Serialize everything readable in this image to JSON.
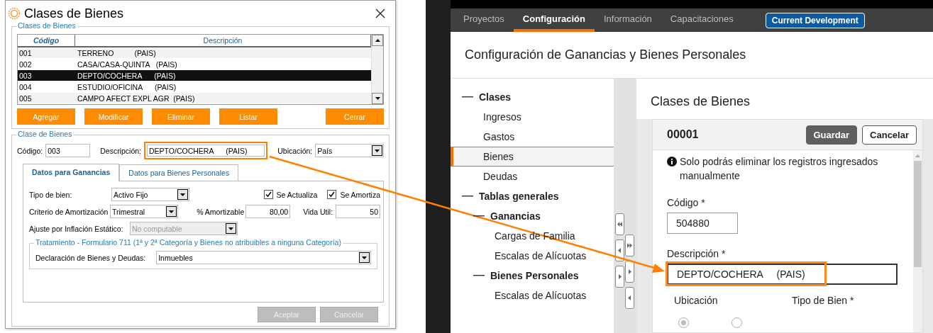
{
  "dialog": {
    "title": "Clases de Bienes",
    "list_group": "Clases de Bienes",
    "table": {
      "columns": [
        "Código",
        "Descripción"
      ],
      "rows": [
        {
          "code": "001",
          "description": "TERRENO          (PAIS)",
          "selected": false
        },
        {
          "code": "002",
          "description": "CASA/CASA-QUINTA   (PAIS)",
          "selected": false
        },
        {
          "code": "003",
          "description": "DEPTO/COCHERA      (PAIS)",
          "selected": true
        },
        {
          "code": "004",
          "description": "ESTUDIO/OFICINA      (PAIS)",
          "selected": false
        },
        {
          "code": "005",
          "description": "CAMPO AFECT EXPL AGR  (PAIS)",
          "selected": false
        }
      ]
    },
    "buttons": [
      {
        "label": "Agregar"
      },
      {
        "label": "Modificar"
      },
      {
        "label": "Eliminar"
      },
      {
        "label": "Listar"
      },
      {
        "label": "Cerrar"
      }
    ],
    "detail_group": "Clase de Bienes",
    "codigo": {
      "label": "Código:",
      "value": "003"
    },
    "descripcion": {
      "label": "Descripción:",
      "value": "DEPTO/COCHERA      (PAIS)",
      "highlighted": true
    },
    "ubicacion": {
      "label": "Ubicación:",
      "value": "País"
    },
    "tabs": [
      {
        "label": "Datos para Ganancias",
        "selected": true
      },
      {
        "label": "Datos para Bienes Personales",
        "selected": false
      }
    ],
    "tipo": {
      "label": "Tipo de bien:",
      "value": "Activo Fijo"
    },
    "checks": [
      {
        "label": "Se Actualiza",
        "checked": true
      },
      {
        "label": "Se Amortiza",
        "checked": true
      }
    ],
    "criterio": {
      "label": "Criterio de Amortización",
      "value": "Trimestral"
    },
    "amortizable": {
      "label": "% Amortizable",
      "value": "80,00"
    },
    "vida": {
      "label": "Vida Util:",
      "value": "50"
    },
    "ajuste": {
      "label": "Ajuste por Inflación Estático:",
      "value": "No computable",
      "disabled": true
    },
    "tratamiento": {
      "title": "Tratamiento - Formulario 711 (1ª y 2ª Categoría y Bienes no atribuibles a ninguna Categoría)",
      "label": "Declaración de Bienes y Deudas:",
      "value": "Inmuebles"
    },
    "footer_buttons": [
      {
        "label": "Aceptar",
        "disabled": true
      },
      {
        "label": "Cancelar",
        "disabled": true
      }
    ]
  },
  "app": {
    "nav": [
      {
        "label": "Proyectos",
        "selected": false
      },
      {
        "label": "Configuración",
        "selected": true
      },
      {
        "label": "Información",
        "selected": false
      },
      {
        "label": "Capacitaciones",
        "selected": false
      }
    ],
    "badge": "Current Development",
    "page_title": "Configuración de Ganancias y Bienes Personales",
    "sidebar": {
      "items": [
        {
          "label": "Clases",
          "expanded": true,
          "selected": false,
          "children": [
            {
              "label": "Ingresos",
              "selected": false
            },
            {
              "label": "Gastos",
              "selected": false
            },
            {
              "label": "Bienes",
              "selected": true
            },
            {
              "label": "Deudas",
              "selected": false
            }
          ]
        },
        {
          "label": "Tablas generales",
          "expanded": true,
          "selected": false,
          "children": [
            {
              "label": "Ganancias",
              "expanded": true,
              "selected": false,
              "children": [
                {
                  "label": "Cargas de Familia",
                  "selected": false
                },
                {
                  "label": "Escalas de Alícuotas",
                  "selected": false
                }
              ]
            },
            {
              "label": "Bienes Personales",
              "expanded": true,
              "selected": false,
              "children": [
                {
                  "label": "Escalas de Alícuotas",
                  "selected": false
                }
              ]
            }
          ]
        }
      ]
    },
    "content": {
      "title": "Clases de Bienes",
      "record": "00001",
      "buttons": [
        {
          "label": "Guardar",
          "kind": "primary"
        },
        {
          "label": "Cancelar",
          "kind": "secondary"
        }
      ],
      "info": "Solo podrás eliminar los registros ingresados manualmente",
      "fields": [
        {
          "label": "Código *",
          "value": "504880",
          "highlighted": false
        },
        {
          "label": "Descripción *",
          "value": "DEPTO/COCHERA     (PAIS)",
          "highlighted": true
        }
      ],
      "ubicacion": {
        "label": "Ubicación",
        "options": [
          {
            "selected": true
          },
          {
            "selected": false
          }
        ]
      },
      "tipo_label": "Tipo de Bien *"
    }
  },
  "callout_arrow": true
}
